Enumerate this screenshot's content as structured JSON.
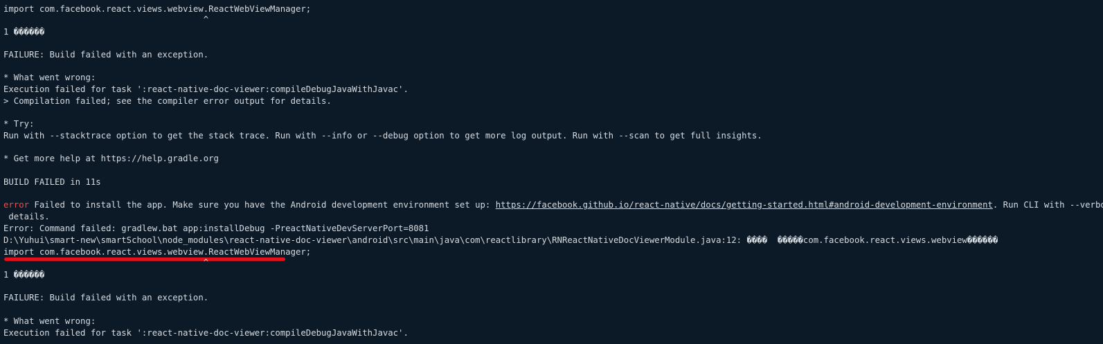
{
  "terminal": {
    "partial_top": "                                          \u0000",
    "lines": {
      "l0": "",
      "l1": "import com.facebook.react.views.webview.ReactWebViewManager;",
      "l2": "                                       ^",
      "l3": "1 ������",
      "l4": "FAILURE: Build failed with an exception.",
      "l5": "* What went wrong:",
      "l6": "Execution failed for task ':react-native-doc-viewer:compileDebugJavaWithJavac'.",
      "l7": "> Compilation failed; see the compiler error output for details.",
      "l8": "* Try:",
      "l9": "Run with --stacktrace option to get the stack trace. Run with --info or --debug option to get more log output. Run with --scan to get full insights.",
      "l10": "* Get more help at https://help.gradle.org",
      "l11": "BUILD FAILED in 11s",
      "l12_error": "error",
      "l12_text": " Failed to install the app. Make sure you have the Android development environment set up: ",
      "l12_link": "https://facebook.github.io/react-native/docs/getting-started.html#android-development-environment",
      "l12_tail": ". Run CLI with --verbose flag for",
      "l13": " details.",
      "l14": "Error: Command failed: gradlew.bat app:installDebug -PreactNativeDevServerPort=8081",
      "l15": "D:\\Yuhui\\smart-new\\smartSchool\\node_modules\\react-native-doc-viewer\\android\\src\\main\\java\\com\\reactlibrary\\RNReactNativeDocViewerModule.java:12: ����  �����com.facebook.react.views.webview������",
      "l16": "import com.facebook.react.views.webview.ReactWebViewManager;",
      "l17": "                                       ^",
      "l18": "1 ������",
      "l19": "FAILURE: Build failed with an exception.",
      "l20": "* What went wrong:",
      "l21": "Execution failed for task ':react-native-doc-viewer:compileDebugJavaWithJavac'."
    }
  },
  "colors": {
    "background": "#0c1a27",
    "text": "#d6dbe0",
    "error": "#f14c4c",
    "annotation": "#e0121c"
  }
}
